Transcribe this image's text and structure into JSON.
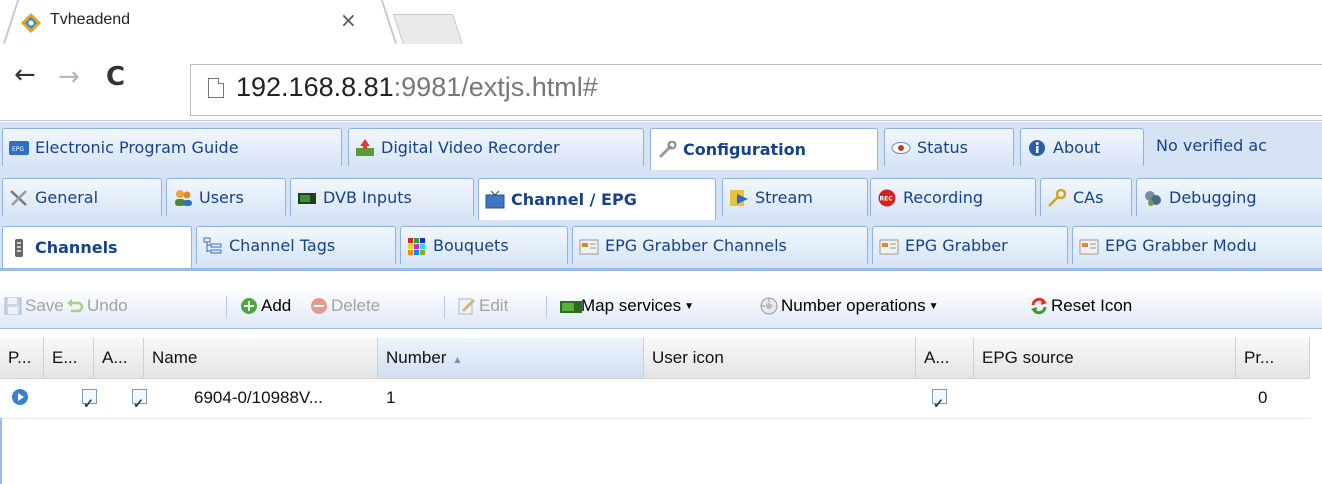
{
  "browser": {
    "tab_title": "Tvheadend",
    "tab_close": "×",
    "url_host": "192.168.8.81",
    "url_rest": ":9981/extjs.html#"
  },
  "main_tabs": [
    {
      "label": "Electronic Program Guide",
      "icon": "epg-icon"
    },
    {
      "label": "Digital Video Recorder",
      "icon": "recorder-icon"
    },
    {
      "label": "Configuration",
      "icon": "wrench-icon",
      "active": true
    },
    {
      "label": "Status",
      "icon": "eye-icon"
    },
    {
      "label": "About",
      "icon": "info-icon"
    }
  ],
  "status_text": "No verified ac",
  "config_tabs": [
    {
      "label": "General",
      "icon": "tools-icon"
    },
    {
      "label": "Users",
      "icon": "users-icon"
    },
    {
      "label": "DVB Inputs",
      "icon": "card-icon"
    },
    {
      "label": "Channel / EPG",
      "icon": "tv-icon",
      "active": true
    },
    {
      "label": "Stream",
      "icon": "stream-icon"
    },
    {
      "label": "Recording",
      "icon": "rec-icon"
    },
    {
      "label": "CAs",
      "icon": "key-icon"
    },
    {
      "label": "Debugging",
      "icon": "bug-icon"
    }
  ],
  "sub_tabs": [
    {
      "label": "Channels",
      "icon": "remote-icon",
      "active": true
    },
    {
      "label": "Channel Tags",
      "icon": "tags-icon"
    },
    {
      "label": "Bouquets",
      "icon": "bouquet-icon"
    },
    {
      "label": "EPG Grabber Channels",
      "icon": "grabber-icon"
    },
    {
      "label": "EPG Grabber",
      "icon": "grabber-icon"
    },
    {
      "label": "EPG Grabber Modu",
      "icon": "grabber-icon"
    }
  ],
  "toolbar": {
    "save": "Save",
    "undo": "Undo",
    "add": "Add",
    "delete": "Delete",
    "edit": "Edit",
    "map_services": "Map services",
    "number_operations": "Number operations",
    "reset_icon": "Reset Icon"
  },
  "grid": {
    "columns": [
      "P...",
      "E...",
      "A...",
      "Name",
      "Number",
      "User icon",
      "A...",
      "EPG source",
      "Pr..."
    ],
    "sorted_column": "Number",
    "sort_direction": "ascending",
    "rows": [
      {
        "play": true,
        "enabled": true,
        "autoname": true,
        "name": "6904-0/10988V...",
        "number": "1",
        "user_icon": "",
        "a2": true,
        "epg_source": "",
        "priority": "0"
      }
    ]
  },
  "colors": {
    "tab_bg": "#d5e3f5",
    "tab_border": "#8db2e3",
    "tab_text": "#15428b",
    "accent": "#99bbe8"
  }
}
